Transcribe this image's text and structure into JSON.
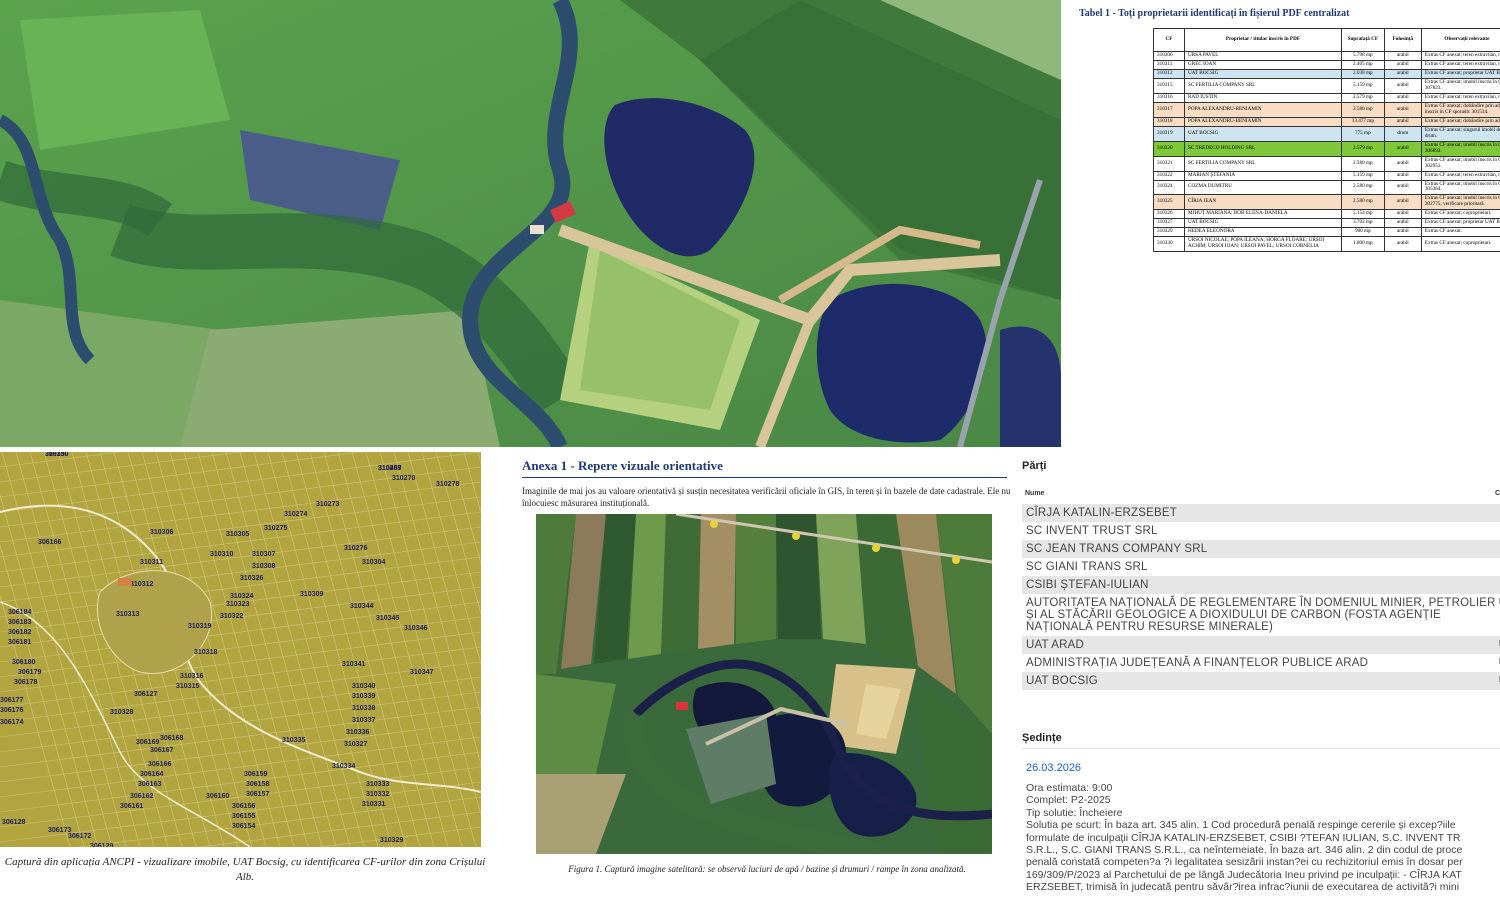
{
  "table": {
    "title": "Tabel 1 - Toți proprietarii identificați în fișierul PDF centralizat",
    "headers": [
      "CF",
      "Proprietar / titular înscris în PDF",
      "Suprafață CF",
      "Folosință",
      "Observații relevante"
    ],
    "rows": [
      {
        "cf": "310306",
        "owner": "URSA PAVEL",
        "area": "5.798 mp",
        "use": "arabil",
        "obs": "Extras CF anexat; teren extravilan, n",
        "hl": ""
      },
      {
        "cf": "310311",
        "owner": "GREC IOAN",
        "area": "2.405 mp",
        "use": "arabil",
        "obs": "Extras CF anexat; teren extravilan, n",
        "hl": ""
      },
      {
        "cf": "310312",
        "owner": "UAT BOCSIG",
        "area": "2.038 mp",
        "use": "arabil",
        "obs": "Extras CF anexat; proprietar UAT B",
        "hl": "blue"
      },
      {
        "cf": "310315",
        "owner": "SC FERTILIA COMPANY SRL",
        "area": "5.159 mp",
        "use": "arabil",
        "obs": "Extras CF anexat; imobil înscris în C 307823.",
        "hl": ""
      },
      {
        "cf": "310316",
        "owner": "RAD IUSTIN",
        "area": "2.579 mp",
        "use": "arabil",
        "obs": "Extras CF anexat; teren extravilan, n",
        "hl": ""
      },
      {
        "cf": "310317",
        "owner": "POPA ALEXANDRU-BENIAMIN",
        "area": "2.580 mp",
        "use": "arabil",
        "obs": "Extras CF anexat; dobândire prin adj înscris în CF sporadic 301534.",
        "hl": "peach"
      },
      {
        "cf": "310318",
        "owner": "POPA ALEXANDRU-BENIAMIN",
        "area": "13.477 mp",
        "use": "arabil",
        "obs": "Extras CF anexat; dobândire prin adj",
        "hl": "peach"
      },
      {
        "cf": "310319",
        "owner": "UAT BOCSIG",
        "area": "775 mp",
        "use": "drum",
        "obs": "Extras CF anexat; singurul imobil de drum.",
        "hl": "blue"
      },
      {
        "cf": "310320",
        "owner": "SC TREDECO HOLDING SRL",
        "area": "2.579 mp",
        "use": "arabil",
        "obs": "Extras CF anexat; imobil înscris în C 306893.",
        "hl": "green"
      },
      {
        "cf": "310321",
        "owner": "SC FERTILIA COMPANY SRL",
        "area": "2.580 mp",
        "use": "arabil",
        "obs": "Extras CF anexat; imobil înscris în C 302951.",
        "hl": ""
      },
      {
        "cf": "310322",
        "owner": "MARIAN ȘTEFANIA",
        "area": "5.159 mp",
        "use": "arabil",
        "obs": "Extras CF anexat; teren extravilan, n",
        "hl": ""
      },
      {
        "cf": "310324",
        "owner": "COZMA DUMITRU",
        "area": "2.580 mp",
        "use": "arabil",
        "obs": "Extras CF anexat; imobil înscris în C 305364.",
        "hl": ""
      },
      {
        "cf": "310325",
        "owner": "CÎRJA JEAN",
        "area": "2.580 mp",
        "use": "arabil",
        "obs": "Extras CF anexat; imobil înscris în C 302775; verificare prioritară.",
        "hl": "peach"
      },
      {
        "cf": "310326",
        "owner": "MIHUȚ MARIANA; BOB ELENA-DANIELA",
        "area": "5.154 mp",
        "use": "arabil",
        "obs": "Extras CF anexat; coproprietari.",
        "hl": ""
      },
      {
        "cf": "310327",
        "owner": "UAT BOCSIG",
        "area": "3.702 mp",
        "use": "arabil",
        "obs": "Extras CF anexat; proprietar UAT B",
        "hl": ""
      },
      {
        "cf": "310329",
        "owner": "HEDEA ELEONORA",
        "area": "900 mp",
        "use": "arabil",
        "obs": "Extras CF anexat.",
        "hl": ""
      },
      {
        "cf": "310330",
        "owner": "URSOI NICOLAE; POPA ILEANA; HORGA FLOARE; URSOI ACHIM; URSOI IOAN; URSOI PAVEL; URSOI CORNELIA",
        "area": "1.000 mp",
        "use": "arabil",
        "obs": "Extras CF anexat; coproprietari.",
        "hl": ""
      }
    ]
  },
  "cadastral": {
    "parcel_labels": [
      "310350",
      "310269",
      "310270",
      "310278",
      "310274",
      "310273",
      "310306",
      "310305",
      "310275",
      "306166",
      "310311",
      "310310",
      "310307",
      "310308",
      "310276",
      "310304",
      "310326",
      "310312",
      "310324",
      "310309",
      "310323",
      "310322",
      "310344",
      "310345",
      "310346",
      "310313",
      "310319",
      "310318",
      "310341",
      "310347",
      "310316",
      "310315",
      "310340",
      "310339",
      "310338",
      "310337",
      "310336",
      "310335",
      "310327",
      "310334",
      "310333",
      "310332",
      "310331",
      "310329",
      "310328",
      "306168",
      "306167",
      "306169",
      "306166",
      "306164",
      "306163",
      "306162",
      "306161",
      "306159",
      "306158",
      "306157",
      "306156",
      "306155",
      "306154",
      "306160",
      "306184",
      "306183",
      "306182",
      "306181",
      "306180",
      "306179",
      "306178",
      "306177",
      "306176",
      "306174",
      "306173",
      "306172",
      "306129",
      "306128",
      "306127",
      "306130",
      "310437"
    ],
    "caption": "Captură din aplicația ANCPI - vizualizare imobile, UAT Bocsig, cu identificarea CF-urilor din zona Crișului Alb."
  },
  "annex": {
    "title": "Anexa 1 - Repere vizuale orientative",
    "intro": "Imaginile de mai jos au valoare orientativă și susțin necesitatea verificării oficiale în GIS, în teren și în bazele de date cadastrale. Ele nu înlocuiesc măsurarea instituțională.",
    "figure_caption": "Figura 1. Captură imagine satelitară: se observă luciuri de apă / bazine și drumuri / rampe în zona analizată."
  },
  "court": {
    "parties_heading": "Părți",
    "col_name": "Nume",
    "col_role": "C",
    "parties": [
      {
        "name": "CÎRJA KATALIN-ERZSEBET",
        "role": "I"
      },
      {
        "name": "SC INVENT TRUST SRL",
        "role": "I"
      },
      {
        "name": "SC JEAN TRANS COMPANY SRL",
        "role": "I"
      },
      {
        "name": "SC GIANI TRANS SRL",
        "role": "I"
      },
      {
        "name": "CSIBI ȘTEFAN-IULIAN",
        "role": "I"
      },
      {
        "name": "AUTORITATEA NAȚIONALĂ DE REGLEMENTARE ÎN DOMENIUL MINIER, PETROLIER ȘI AL STĂCĂRII GEOLOGICE A DIOXIDULUI DE CARBON (FOSTA AGENȚIE NAȚIONALĂ PENTRU RESURSE MINERALE)",
        "role": "P"
      },
      {
        "name": "UAT ARAD",
        "role": "P"
      },
      {
        "name": "ADMINISTRAȚIA JUDEȚEANĂ A FINANȚELOR PUBLICE ARAD",
        "role": "P"
      },
      {
        "name": "UAT BOCSIG",
        "role": "P"
      }
    ],
    "sessions_heading": "Ședințe",
    "session_date": "26.03.2026",
    "session_lines": [
      "Ora estimata: 9:00",
      "Complet: P2-2025",
      "Tip solutie: Încheiere",
      "Solutia pe scurt: În baza art. 345 alin. 1 Cod procedură penală respinge cererile și excep?iile",
      "formulate de inculpații CÎRJA KATALIN-ERZSEBET, CSIBI ?TEFAN IULIAN, S.C. INVENT TR",
      "S.R.L., S.C. GIANI TRANS S.R.L., ca neîntemeiate. În baza art. 346 alin. 2 din codul de proce",
      "penală constată competen?a ?i legalitatea sesizării instan?ei cu rechizitoriul emis în dosar per",
      "169/309/P/2023 al Parchetului de pe lângă Judecătoria Ineu privind pe inculpații: - CÎRJA KAT",
      "ERZSEBET, trimisă în judecată pentru săvâr?irea infrac?iunii de executarea de activită?i mini"
    ]
  }
}
